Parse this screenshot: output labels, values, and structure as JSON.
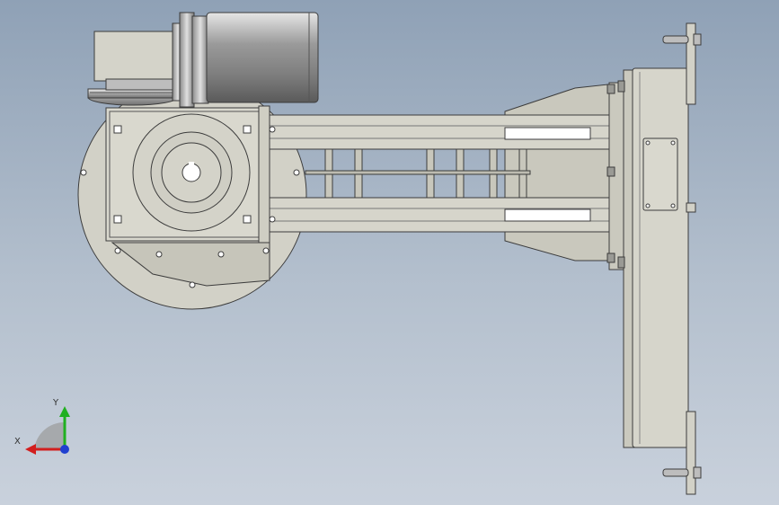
{
  "viewport": {
    "background_top": "#8fa1b6",
    "background_bottom": "#c9d1dc"
  },
  "part_colors": {
    "body": "#d2d1c7",
    "edge": "#3c3c3c",
    "dark": "#6e6e6a",
    "motor": "#aaaaaa",
    "slot": "#ffffff"
  },
  "triad": {
    "x_label": "X",
    "y_label": "Y",
    "x_color": "#d21e1e",
    "y_color": "#20b020",
    "z_color": "#2040d0"
  }
}
